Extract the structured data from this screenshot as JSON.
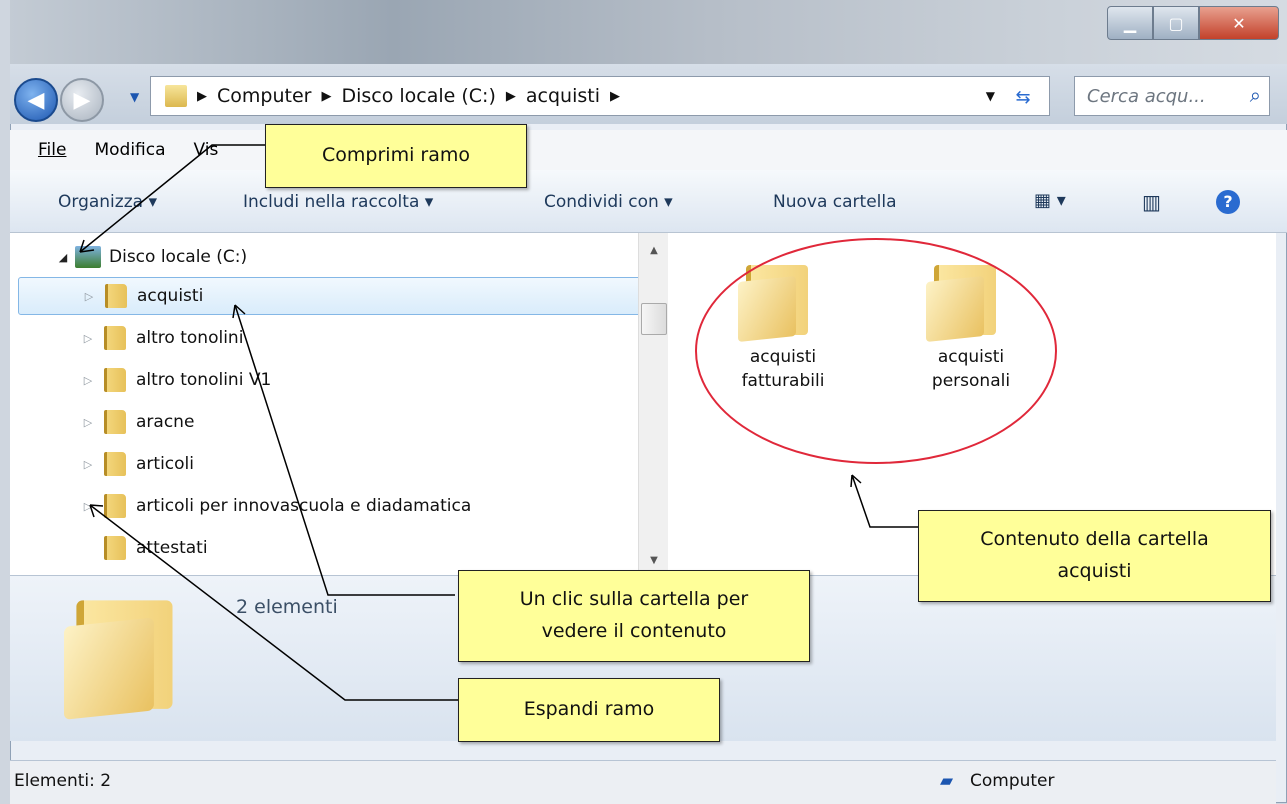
{
  "address": {
    "crumbs": [
      "Computer",
      "Disco locale (C:)",
      "acquisti"
    ],
    "search_placeholder": "Cerca acqu..."
  },
  "menu": [
    "File",
    "Modifica",
    "Vis"
  ],
  "toolbar": {
    "organize": "Organizza ▾",
    "include": "Includi nella raccolta ▾",
    "share": "Condividi con ▾",
    "new_folder": "Nuova cartella"
  },
  "tree": {
    "root": "Disco locale (C:)",
    "items": [
      "acquisti",
      "altro tonolini",
      "altro tonolini V1",
      "aracne",
      "articoli",
      "articoli per innovascuola e diadamatica",
      "attestati"
    ]
  },
  "content": {
    "folders": [
      {
        "line1": "acquisti",
        "line2": "fatturabili"
      },
      {
        "line1": "acquisti",
        "line2": "personali"
      }
    ]
  },
  "details": {
    "count": "2 elementi"
  },
  "status": {
    "left": "Elementi: 2",
    "right": "Computer"
  },
  "callouts": {
    "collapse": "Comprimi ramo",
    "click": "Un clic sulla cartella per vedere il contenuto",
    "expand": "Espandi ramo",
    "content": "Contenuto della cartella acquisti"
  },
  "colors": {
    "callout_bg": "#ffff99",
    "highlight_ellipse": "#e0283a"
  }
}
